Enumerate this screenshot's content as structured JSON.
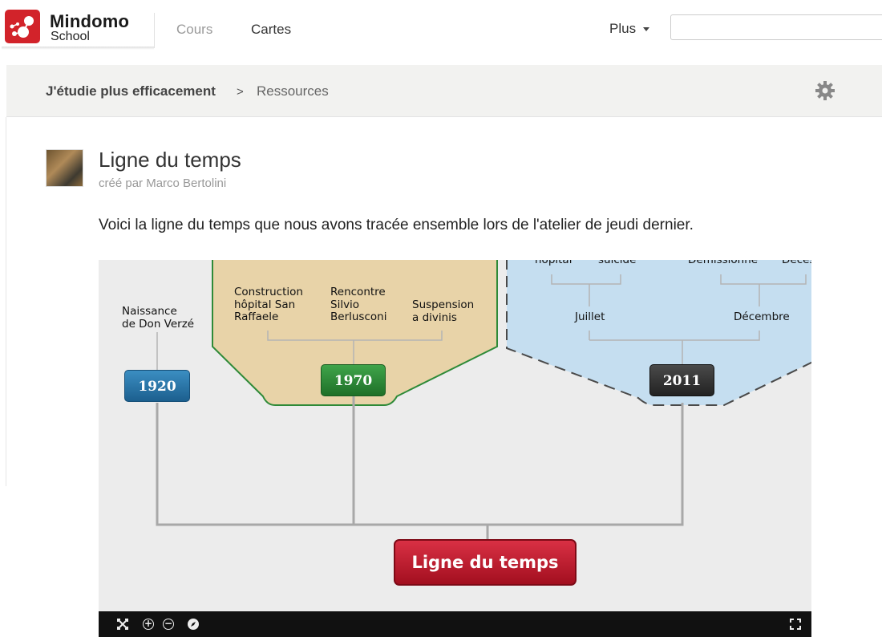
{
  "brand": {
    "name": "Mindomo",
    "sub": "School"
  },
  "nav": {
    "cours": "Cours",
    "cartes": "Cartes",
    "plus": "Plus"
  },
  "search": {
    "placeholder": ""
  },
  "breadcrumb": {
    "parent": "J'étudie plus efficacement",
    "separator": ">",
    "current": "Ressources"
  },
  "page": {
    "title": "Ligne du temps",
    "author": "créé par Marco Bertolini",
    "description": "Voici la ligne du temps que nous avons tracée ensemble lors de l'atelier de jeudi dernier."
  },
  "map": {
    "central": "Ligne du temps",
    "topics": [
      {
        "label": "1920",
        "color": "#2a78ab",
        "children": [
          "Naissance\nde Don Verzé"
        ]
      },
      {
        "label": "1970",
        "color": "#2e8a38",
        "fill": "#e8d3a8",
        "children": [
          "Construction\nhôpital San\nRaffaele",
          "Rencontre\nSilvio\nBerlusconi",
          "Suspension\na divinis"
        ]
      },
      {
        "label": "2011",
        "color": "#333333",
        "fill": "#c5def0",
        "children": [
          "Juillet",
          "Décembre"
        ],
        "grandchildren_partial": [
          "hôpital",
          "suicide",
          "Démissionne",
          "Décès"
        ]
      }
    ]
  },
  "toolbar": {
    "icons": [
      "fit-icon",
      "zoom-in-icon",
      "zoom-out-icon",
      "compass-icon",
      "fullscreen-icon"
    ]
  }
}
